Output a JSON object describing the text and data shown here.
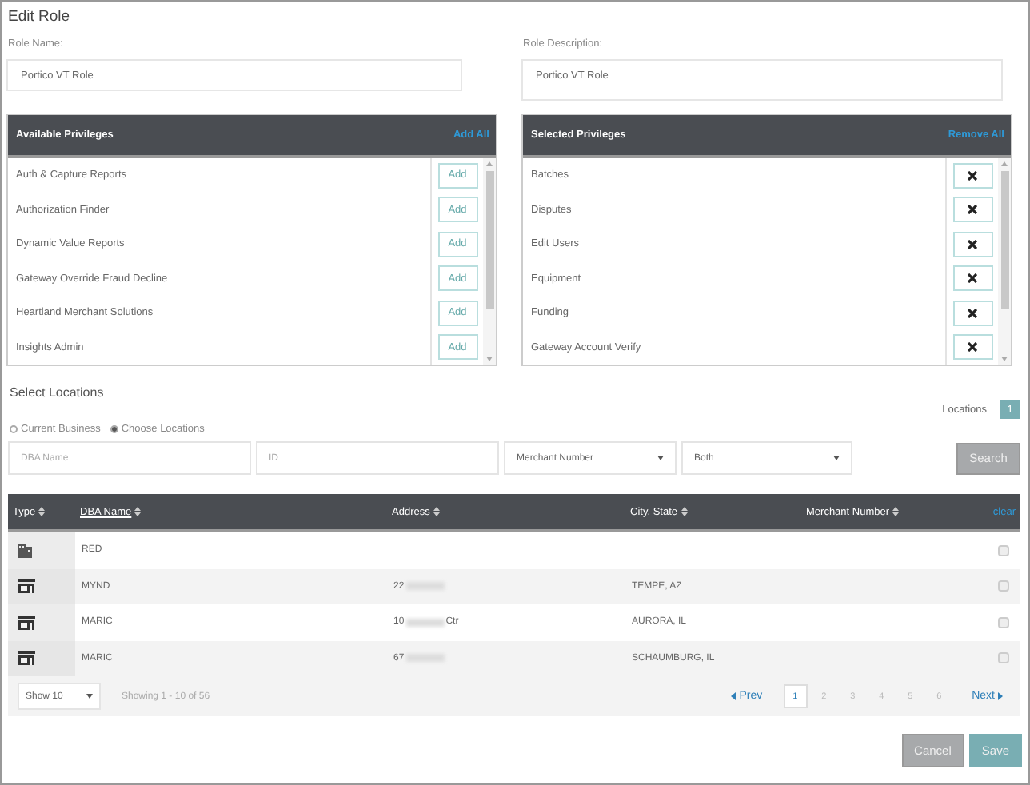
{
  "title": "Edit Role",
  "role_name": {
    "label": "Role Name:",
    "value": "Portico VT Role"
  },
  "role_description": {
    "label": "Role Description:",
    "value": "Portico VT Role"
  },
  "available_privileges": {
    "title": "Available Privileges",
    "action": "Add All",
    "items": [
      {
        "name": "Auth & Capture Reports",
        "button": "Add"
      },
      {
        "name": "Authorization Finder",
        "button": "Add"
      },
      {
        "name": "Dynamic Value Reports",
        "button": "Add"
      },
      {
        "name": "Gateway Override Fraud Decline",
        "button": "Add"
      },
      {
        "name": "Heartland Merchant Solutions",
        "button": "Add"
      },
      {
        "name": "Insights Admin",
        "button": "Add"
      }
    ]
  },
  "selected_privileges": {
    "title": "Selected Privileges",
    "action": "Remove All",
    "items": [
      {
        "name": "Batches"
      },
      {
        "name": "Disputes"
      },
      {
        "name": "Edit Users"
      },
      {
        "name": "Equipment"
      },
      {
        "name": "Funding"
      },
      {
        "name": "Gateway Account Verify"
      }
    ]
  },
  "locations": {
    "title": "Select Locations",
    "count_label": "Locations",
    "count": "1",
    "scope_options": [
      {
        "label": "Current Business",
        "selected": false
      },
      {
        "label": "Choose Locations",
        "selected": true
      }
    ],
    "filters": {
      "dba_placeholder": "DBA Name",
      "id_placeholder": "ID",
      "field_select": "Merchant Number",
      "status_select": "Both",
      "search_button": "Search"
    },
    "table": {
      "clear": "clear",
      "columns": [
        {
          "label": "Type",
          "active": false
        },
        {
          "label": "DBA Name",
          "active": true
        },
        {
          "label": "Address",
          "active": false
        },
        {
          "label": "City, State",
          "active": false
        },
        {
          "label": "Merchant Number",
          "active": false
        }
      ],
      "rows": [
        {
          "kind": "building",
          "dba_name": "RED",
          "checked": false
        },
        {
          "kind": "store",
          "dba_name": "MYND",
          "address": [
            "22"
          ],
          "city_state": "TEMPE, AZ",
          "checked": false
        },
        {
          "kind": "store",
          "dba_name": "MARIC",
          "address": [
            "10",
            "Ctr"
          ],
          "city_state": "AURORA, IL",
          "checked": false
        },
        {
          "kind": "store",
          "dba_name": "MARIC",
          "address": [
            "67"
          ],
          "city_state": "SCHAUMBURG, IL",
          "checked": false
        }
      ]
    },
    "pagination": {
      "page_size": "Show 10",
      "summary": "Showing 1 - 10 of 56",
      "prev": "Prev",
      "next": "Next",
      "pages": [
        {
          "label": "1",
          "selected": true
        },
        {
          "label": "2",
          "selected": false
        },
        {
          "label": "3",
          "selected": false
        },
        {
          "label": "4",
          "selected": false
        },
        {
          "label": "5",
          "selected": false
        },
        {
          "label": "6",
          "selected": false
        }
      ]
    }
  },
  "buttons": [
    {
      "label": "Cancel",
      "kind": "secondary"
    },
    {
      "label": "Save",
      "kind": "primary"
    }
  ]
}
